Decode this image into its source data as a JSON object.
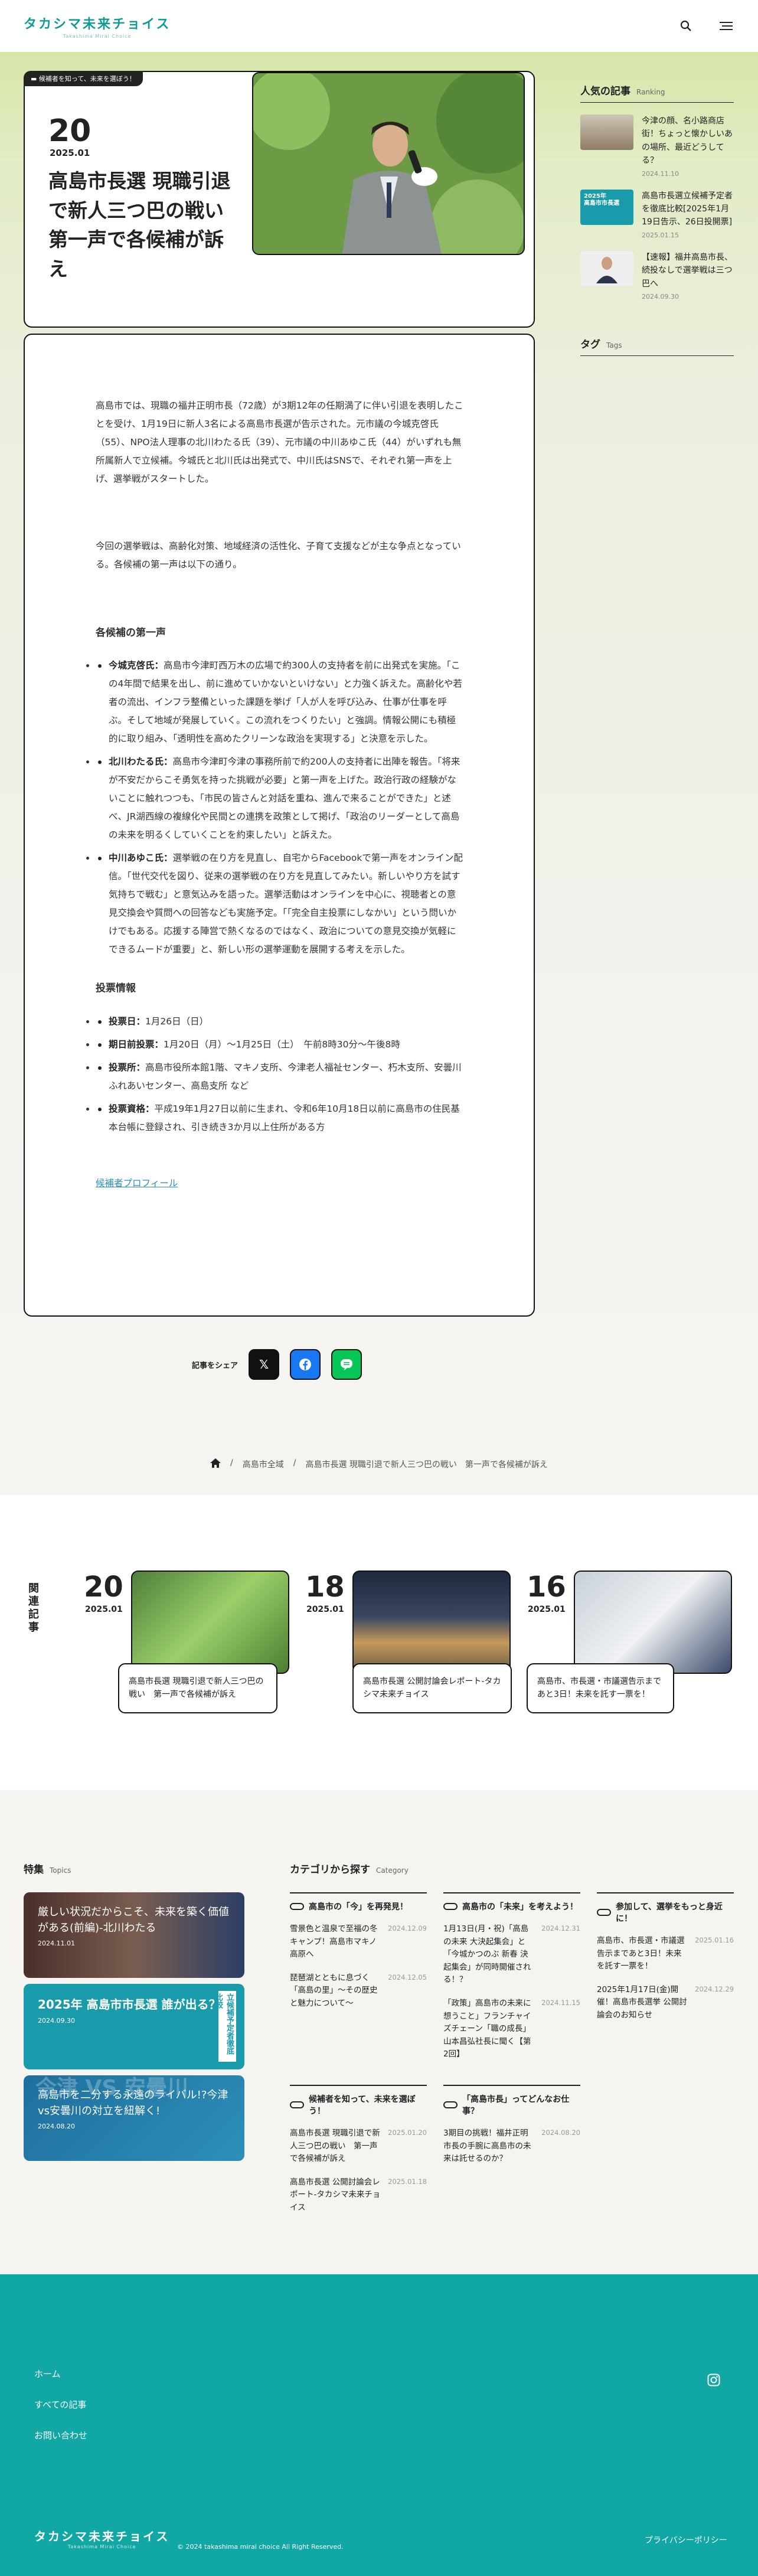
{
  "site": {
    "logo": "タカシマ未来チョイス",
    "logo_sub": "Takashima Mirai Choice"
  },
  "header": {
    "search_icon": "search-icon",
    "menu_icon": "menu-icon"
  },
  "article": {
    "topic_tag": "候補者を知って、未来を選ぼう！",
    "day": "20",
    "year_month": "2025.01",
    "title": "高島市長選 現職引退で新人三つ巴の戦い 第一声で各候補が訴え",
    "p1": "高島市では、現職の福井正明市長（72歳）が3期12年の任期満了に伴い引退を表明したことを受け、1月19日に新人3名による高島市長選が告示された。元市議の今城克啓氏（55）、NPO法人理事の北川わたる氏（39）、元市議の中川あゆこ氏（44）がいずれも無所属新人で立候補。今城氏と北川氏は出発式で、中川氏はSNSで、それぞれ第一声を上げ、選挙戦がスタートした。",
    "p2": "今回の選挙戦は、高齢化対策、地域経済の活性化、子育て支援などが主な争点となっている。各候補の第一声は以下の通り。",
    "h_first": "各候補の第一声",
    "candidates": [
      {
        "name": "今城克啓氏：",
        "text": "高島市今津町西万木の広場で約300人の支持者を前に出発式を実施。「この4年間で結果を出し、前に進めていかないといけない」と力強く訴えた。高齢化や若者の流出、インフラ整備といった課題を挙げ「人が人を呼び込み、仕事が仕事を呼ぶ。そして地域が発展していく。この流れをつくりたい」と強調。情報公開にも積極的に取り組み、「透明性を高めたクリーンな政治を実現する」と決意を示した。"
      },
      {
        "name": "北川わたる氏：",
        "text": "高島市今津町今津の事務所前で約200人の支持者に出陣を報告。「将来が不安だからこそ勇気を持った挑戦が必要」と第一声を上げた。政治行政の経験がないことに触れつつも、「市民の皆さんと対話を重ね、進んで来ることができた」と述べ、JR湖西線の複線化や民間との連携を政策として掲げ、「政治のリーダーとして高島の未来を明るくしていくことを約束したい」と訴えた。"
      },
      {
        "name": "中川あゆこ氏：",
        "text": "選挙戦の在り方を見直し、自宅からFacebookで第一声をオンライン配信。「世代交代を図り、従来の選挙戦の在り方を見直してみたい。新しいやり方を試す気持ちで戦む」と意気込みを語った。選挙活動はオンラインを中心に、視聴者との意見交換会や質問への回答なども実施予定。「「完全自主投票にしなかい」という問いかけでもある。応援する陣営で熱くなるのではなく、政治についての意見交換が気軽にできるムードが重要」と、新しい形の選挙運動を展開する考えを示した。"
      }
    ],
    "h_vote": "投票情報",
    "vote": [
      {
        "k": "投票日：",
        "v": "1月26日（日）"
      },
      {
        "k": "期日前投票：",
        "v": "1月20日（月）〜1月25日（土）　午前8時30分〜午後8時"
      },
      {
        "k": "投票所：",
        "v": "高島市役所本館1階、マキノ支所、今津老人福祉センター、朽木支所、安曇川ふれあいセンター、高島支所 など"
      },
      {
        "k": "投票資格：",
        "v": "平成19年1月27日以前に生まれ、令和6年10月18日以前に高島市の住民基本台帳に登録され、引き続き3か月以上住所がある方"
      }
    ],
    "profile_link": "候補者プロフィール"
  },
  "share": {
    "label": "記事をシェア",
    "x_icon": "x-icon",
    "fb_icon": "facebook-icon",
    "line_icon": "line-icon"
  },
  "breadcrumb": {
    "home_icon": "home-icon",
    "c1": "高島市全域",
    "c2": "高島市長選 現職引退で新人三つ巴の戦い　第一声で各候補が訴え"
  },
  "sidebar": {
    "ranking_title": "人気の記事",
    "ranking_en": "Ranking",
    "ranking": [
      {
        "title": "今津の顔、名小路商店街！ちょっと懐かしいあの場所、最近どうしてる？",
        "date": "2024.11.10"
      },
      {
        "title": "高島市長選立候補予定者を徹底比較[2025年1月19日告示、26日投開票]",
        "date": "2025.01.15"
      },
      {
        "title": "【速報】福井高島市長、続投なしで選挙戦は三つ巴へ",
        "date": "2024.09.30"
      }
    ],
    "tags_title": "タグ",
    "tags_en": "Tags"
  },
  "related": {
    "label": "関連記事",
    "items": [
      {
        "day": "20",
        "ym": "2025.01",
        "title": "高島市長選 現職引退で新人三つ巴の戦い　第一声で各候補が訴え"
      },
      {
        "day": "18",
        "ym": "2025.01",
        "title": "高島市長選 公開討論会レポート-タカシマ未来チョイス"
      },
      {
        "day": "16",
        "ym": "2025.01",
        "title": "高島市、市長選・市議選告示まであと3日！未来を託す一票を！"
      }
    ]
  },
  "topics": {
    "title": "特集",
    "en": "Topics",
    "items": [
      {
        "title": "厳しい状況だからこそ、未来を築く価値がある(前編)-北川わたる",
        "date": "2024.11.01"
      },
      {
        "title": "2025年 高島市市長選 誰が出る？",
        "badge": "立候補予定者徹底比較",
        "date": "2024.09.30"
      },
      {
        "title": "高島市を二分する永遠のライバル!?今津vs安曇川の対立を紐解く!",
        "date": "2024.08.20",
        "bg": "今津 VS 安曇川"
      }
    ]
  },
  "categories": {
    "title": "カテゴリから探す",
    "en": "Category",
    "groups": [
      {
        "name": "高島市の「今」を再発見！",
        "items": [
          {
            "t": "雪景色と温泉で至福の冬キャンプ！高島市マキノ高原へ",
            "d": "2024.12.09"
          },
          {
            "t": "琵琶湖とともに息づく「高島の里」～その歴史と魅力について～",
            "d": "2024.12.05"
          }
        ]
      },
      {
        "name": "高島市の「未来」を考えよう！",
        "items": [
          {
            "t": "1月13日(月・祝)「高島の未来 大決起集会」と「今城かつのぶ 新春 決起集会」が同時開催される！？",
            "d": "2024.12.31"
          },
          {
            "t": "「政策」高島市の未来に想うこと」フランチャイズチェーン「職の成長」山本昌弘社長に聞く【第2回】",
            "d": "2024.11.15"
          }
        ]
      },
      {
        "name": "参加して、選挙をもっと身近に！",
        "items": [
          {
            "t": "高島市、市長選・市議選告示まであと3日！未来を託す一票を！",
            "d": "2025.01.16"
          },
          {
            "t": "2025年1月17日(金)開催！高島市長選挙 公開討論会のお知らせ",
            "d": "2024.12.29"
          }
        ]
      },
      {
        "name": "候補者を知って、未来を選ぼう！",
        "items": [
          {
            "t": "高島市長選 現職引退で新人三つ巴の戦い　第一声で各候補が訴え",
            "d": "2025.01.20"
          },
          {
            "t": "高島市長選 公開討論会レポート-タカシマ未来チョイス",
            "d": "2025.01.18"
          }
        ]
      },
      {
        "name": "「高島市長」ってどんなお仕事？",
        "items": [
          {
            "t": "3期目の挑戦！福井正明市長の手腕に高島市の未来は託せるのか？",
            "d": "2024.08.20"
          }
        ]
      }
    ]
  },
  "footer": {
    "links": [
      "ホーム",
      "すべての記事",
      "お問い合わせ"
    ],
    "instagram_icon": "instagram-icon",
    "logo": "タカシマ未来チョイス",
    "logo_sub": "Takashima Mirai Choice",
    "copyright": "© 2024 takashima mirai choice All Right Reserved.",
    "privacy": "プライバシーポリシー"
  },
  "colors": {
    "brand": "#0e9a96",
    "footer": "#10a7a4",
    "link": "#2a8fb8"
  }
}
